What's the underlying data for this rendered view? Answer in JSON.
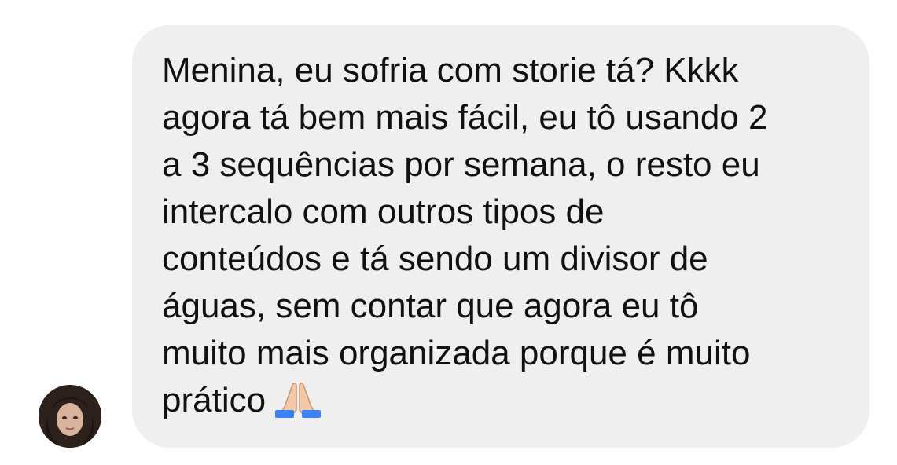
{
  "message": {
    "lines": "Menina, eu sofria com storie tá? Kkkk\nagora tá bem mais fácil, eu tô usando 2\na 3 sequências por semana, o resto eu\nintercalo com outros tipos de\nconteúdos e tá sendo um divisor de\náguas, sem contar que agora eu tô\nmuito mais organizada porque é muito\nprático",
    "emoji_icon": "folded-hands-icon"
  },
  "colors": {
    "bubble_background": "#efefef",
    "text": "#111111",
    "page_background": "#ffffff"
  }
}
